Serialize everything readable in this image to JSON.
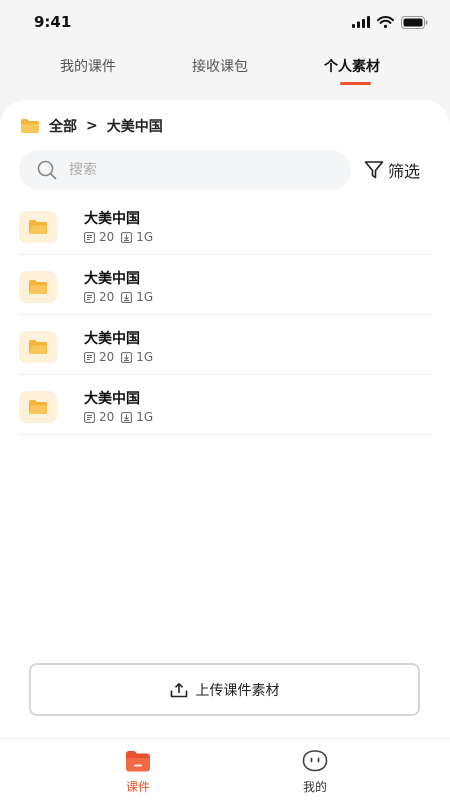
{
  "status_bar": {
    "time": "9:41"
  },
  "top_tabs": [
    {
      "label": "我的课件",
      "active": false
    },
    {
      "label": "接收课包",
      "active": false
    },
    {
      "label": "个人素材",
      "active": true
    }
  ],
  "breadcrumb": {
    "root": "全部",
    "separator": ">",
    "current": "大美中国"
  },
  "search": {
    "placeholder": "搜索"
  },
  "filter": {
    "label": "筛选"
  },
  "files": [
    {
      "name": "大美中国",
      "count": "20",
      "size": "1G"
    },
    {
      "name": "大美中国",
      "count": "20",
      "size": "1G"
    },
    {
      "name": "大美中国",
      "count": "20",
      "size": "1G"
    },
    {
      "name": "大美中国",
      "count": "20",
      "size": "1G"
    }
  ],
  "upload": {
    "label": "上传课件素材"
  },
  "bottom_nav": [
    {
      "label": "课件",
      "icon": "folder-icon",
      "active": true
    },
    {
      "label": "我的",
      "icon": "profile-face-icon",
      "active": false
    }
  ],
  "colors": {
    "accent": "#e8512f",
    "folder": "#f5b53a",
    "folder_tile": "#fdf1d9"
  }
}
